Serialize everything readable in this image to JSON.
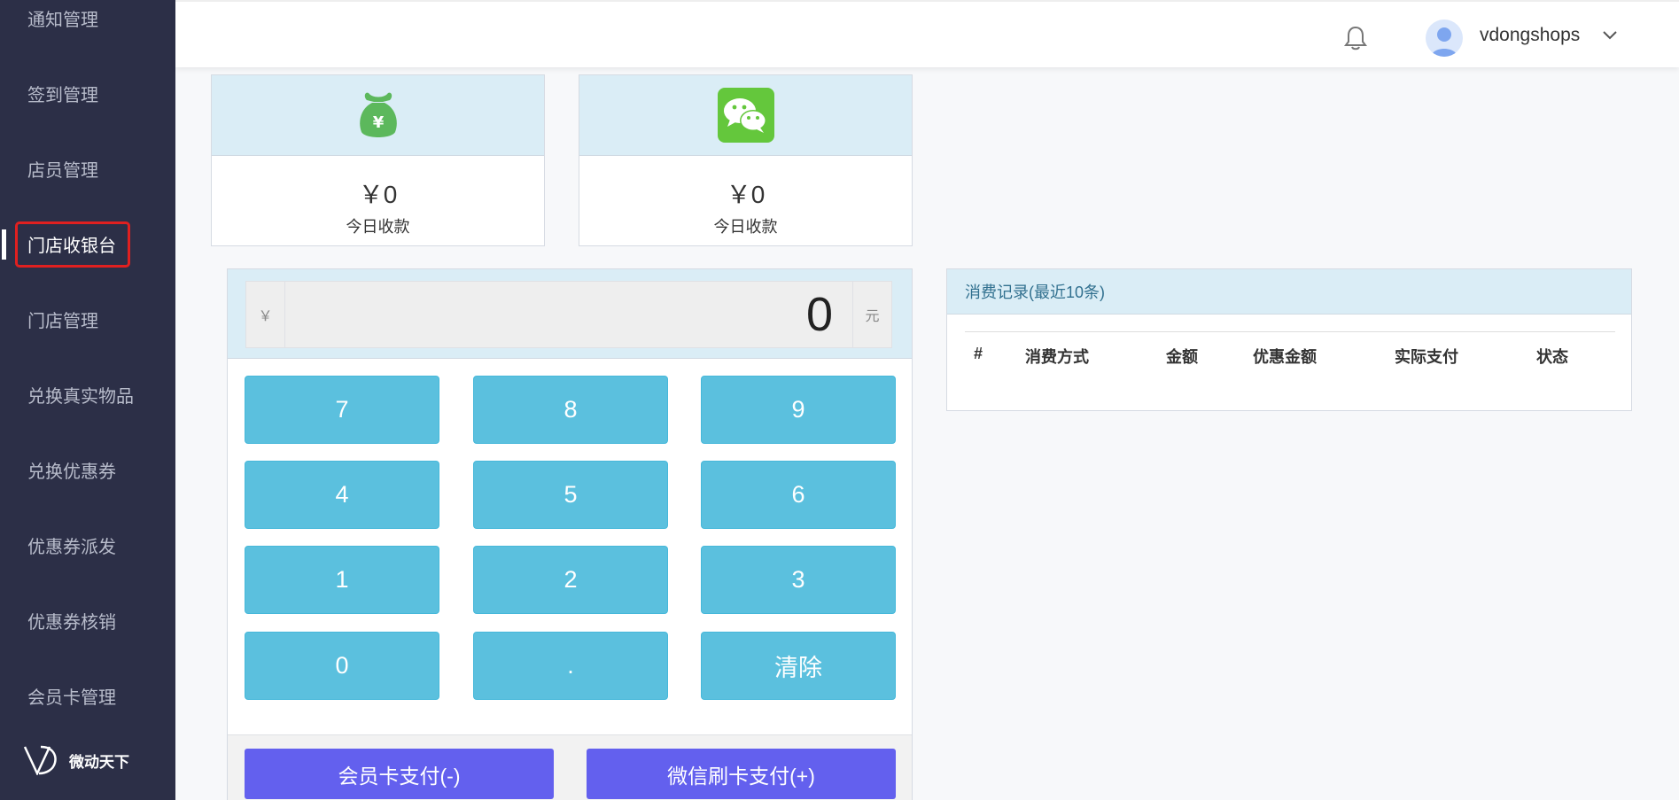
{
  "sidebar": {
    "items": [
      {
        "label": "通知管理"
      },
      {
        "label": "签到管理"
      },
      {
        "label": "店员管理"
      },
      {
        "label": "门店收银台"
      },
      {
        "label": "门店管理"
      },
      {
        "label": "兑换真实物品"
      },
      {
        "label": "兑换优惠券"
      },
      {
        "label": "优惠券派发"
      },
      {
        "label": "优惠券核销"
      },
      {
        "label": "会员卡管理"
      }
    ],
    "active_item": "门店收银台",
    "brand": "微动天下"
  },
  "header": {
    "username": "vdongshops",
    "icons": [
      "bell-icon",
      "avatar",
      "chevron-down-icon"
    ]
  },
  "stats": [
    {
      "icon": "money-bag-icon",
      "icon_color": "#5cb85c",
      "amount": "￥0",
      "label": "今日收款"
    },
    {
      "icon": "wechat-icon",
      "icon_color": "#64c73c",
      "amount": "￥0",
      "label": "今日收款"
    }
  ],
  "calculator": {
    "prefix": "￥",
    "amount": "0",
    "suffix": "元",
    "keys": [
      "7",
      "8",
      "9",
      "4",
      "5",
      "6",
      "1",
      "2",
      "3",
      "0",
      ".",
      "清除"
    ],
    "key_color": "#5bc0de",
    "pay_buttons": {
      "member_card": "会员卡支付(-)",
      "wechat": "微信刷卡支付(+)"
    },
    "pay_color": "#6360ee"
  },
  "records": {
    "title": "消费记录(最近10条)",
    "columns": [
      "#",
      "消费方式",
      "金额",
      "优惠金额",
      "实际支付",
      "状态"
    ]
  }
}
